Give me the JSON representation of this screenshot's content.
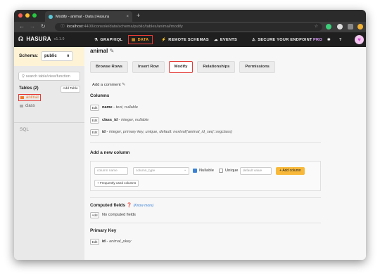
{
  "browser": {
    "tab_title": "Modify - animal - Data | Hasura",
    "tab_close": "×",
    "new_tab": "+",
    "url_host": "localhost",
    "url_path": ":4400/console/data/schema/public/tables/animal/modify"
  },
  "navbar": {
    "logo": "HASURA",
    "version": "v1.1.0",
    "items": {
      "graphiql": "GRAPHIQL",
      "data": "DATA",
      "remote": "REMOTE SCHEMAS",
      "events": "EVENTS",
      "secure": "SECURE YOUR ENDPOINT",
      "pro": "PRO",
      "help": "?"
    }
  },
  "sidebar": {
    "schema_label": "Schema:",
    "schema_value": "public",
    "search_placeholder": "search table/view/function",
    "tables_heading": "Tables (2)",
    "add_table": "Add Table",
    "tables": [
      "animal",
      "class"
    ],
    "sql": "SQL"
  },
  "main": {
    "table_name": "animal",
    "tabs": [
      "Browse Rows",
      "Insert Row",
      "Modify",
      "Relationships",
      "Permissions"
    ],
    "add_comment": "Add a comment",
    "columns_heading": "Columns",
    "columns": [
      {
        "name": "name",
        "type": "text, nullable"
      },
      {
        "name": "class_id",
        "type": "integer, nullable"
      },
      {
        "name": "id",
        "type": "integer, primary key, unique, default: nextval('animal_id_seq'::regclass)"
      }
    ],
    "edit_label": "Edit",
    "add_column_heading": "Add a new column",
    "new_column": {
      "name_placeholder": "column name",
      "type_placeholder": "column_type",
      "nullable": "Nullable",
      "unique": "Unique",
      "default_placeholder": "default value",
      "add_button": "+ Add column",
      "frequent": "+ Frequently used columns"
    },
    "computed_heading": "Computed fields",
    "computed_link": "(Know more)",
    "add_label": "Add",
    "no_computed": "No computed fields",
    "pk_heading": "Primary Key",
    "pk_value": "id",
    "pk_name": "animal_pkey"
  }
}
